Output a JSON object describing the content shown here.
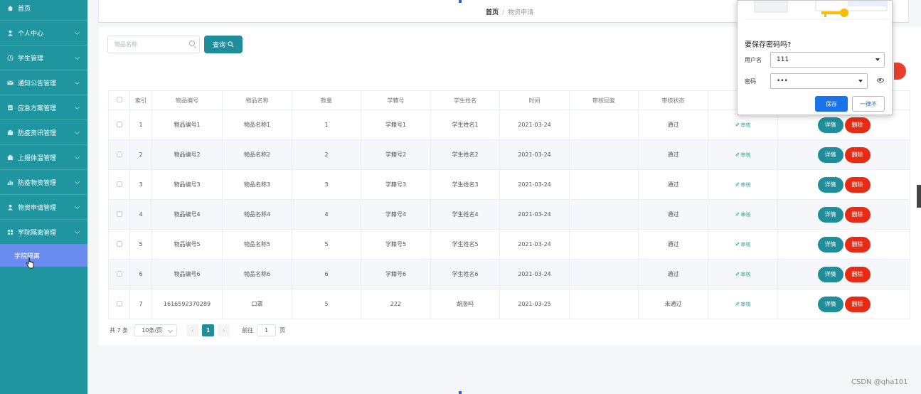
{
  "sidebar": {
    "items": [
      {
        "label": "首页",
        "icon": "home-icon"
      },
      {
        "label": "个人中心",
        "icon": "user-icon"
      },
      {
        "label": "学生管理",
        "icon": "clock-icon"
      },
      {
        "label": "通知公告管理",
        "icon": "mail-icon"
      },
      {
        "label": "应急方案管理",
        "icon": "doc-icon"
      },
      {
        "label": "防疫资讯管理",
        "icon": "building-icon"
      },
      {
        "label": "上报体温管理",
        "icon": "building-icon"
      },
      {
        "label": "防疫物资管理",
        "icon": "bar-chart-icon"
      },
      {
        "label": "物资申请管理",
        "icon": "user-icon"
      },
      {
        "label": "学院隔离管理",
        "icon": "grid-icon"
      }
    ],
    "sub_item": "学院隔离"
  },
  "breadcrumb": {
    "home": "首页",
    "sep": "/",
    "current": "物资申请"
  },
  "search": {
    "placeholder": "物品名称",
    "button": "查询"
  },
  "table": {
    "headers": [
      "",
      "索引",
      "物品编号",
      "物品名称",
      "数量",
      "学籍号",
      "学生姓名",
      "时间",
      "审核回复",
      "审核状态",
      "",
      ""
    ],
    "rows": [
      {
        "idx": "1",
        "code": "物品编号1",
        "name": "物品名称1",
        "qty": "1",
        "sid": "学籍号1",
        "sname": "学生姓名1",
        "time": "2021-03-24",
        "reply": "",
        "status": "通过"
      },
      {
        "idx": "2",
        "code": "物品编号2",
        "name": "物品名称2",
        "qty": "2",
        "sid": "学籍号2",
        "sname": "学生姓名2",
        "time": "2021-03-24",
        "reply": "",
        "status": "通过"
      },
      {
        "idx": "3",
        "code": "物品编号3",
        "name": "物品名称3",
        "qty": "3",
        "sid": "学籍号3",
        "sname": "学生姓名3",
        "time": "2021-03-24",
        "reply": "",
        "status": "通过"
      },
      {
        "idx": "4",
        "code": "物品编号4",
        "name": "物品名称4",
        "qty": "4",
        "sid": "学籍号4",
        "sname": "学生姓名4",
        "time": "2021-03-24",
        "reply": "",
        "status": "通过"
      },
      {
        "idx": "5",
        "code": "物品编号5",
        "name": "物品名称5",
        "qty": "5",
        "sid": "学籍号5",
        "sname": "学生姓名5",
        "time": "2021-03-24",
        "reply": "",
        "status": "通过"
      },
      {
        "idx": "6",
        "code": "物品编号6",
        "name": "物品名称6",
        "qty": "6",
        "sid": "学籍号6",
        "sname": "学生姓名6",
        "time": "2021-03-24",
        "reply": "",
        "status": "通过"
      },
      {
        "idx": "7",
        "code": "1616592370289",
        "name": "口罩",
        "qty": "5",
        "sid": "222",
        "sname": "胡涨吗",
        "time": "2021-03-25",
        "reply": "",
        "status": "未通过"
      }
    ],
    "audit_label": "审核",
    "detail_label": "详情",
    "delete_label": "删除"
  },
  "pagination": {
    "total": "共 7 条",
    "page_size": "10条/页",
    "prev": "‹",
    "current": "1",
    "next": "›",
    "goto": "前往",
    "goto_value": "1",
    "page_unit": "页"
  },
  "password_popup": {
    "title": "要保存密码吗?",
    "username_label": "用户名",
    "username_value": "111",
    "password_label": "密码",
    "password_value": "•••",
    "save": "保存",
    "never": "一律不"
  },
  "watermark": "CSDN @qha101"
}
